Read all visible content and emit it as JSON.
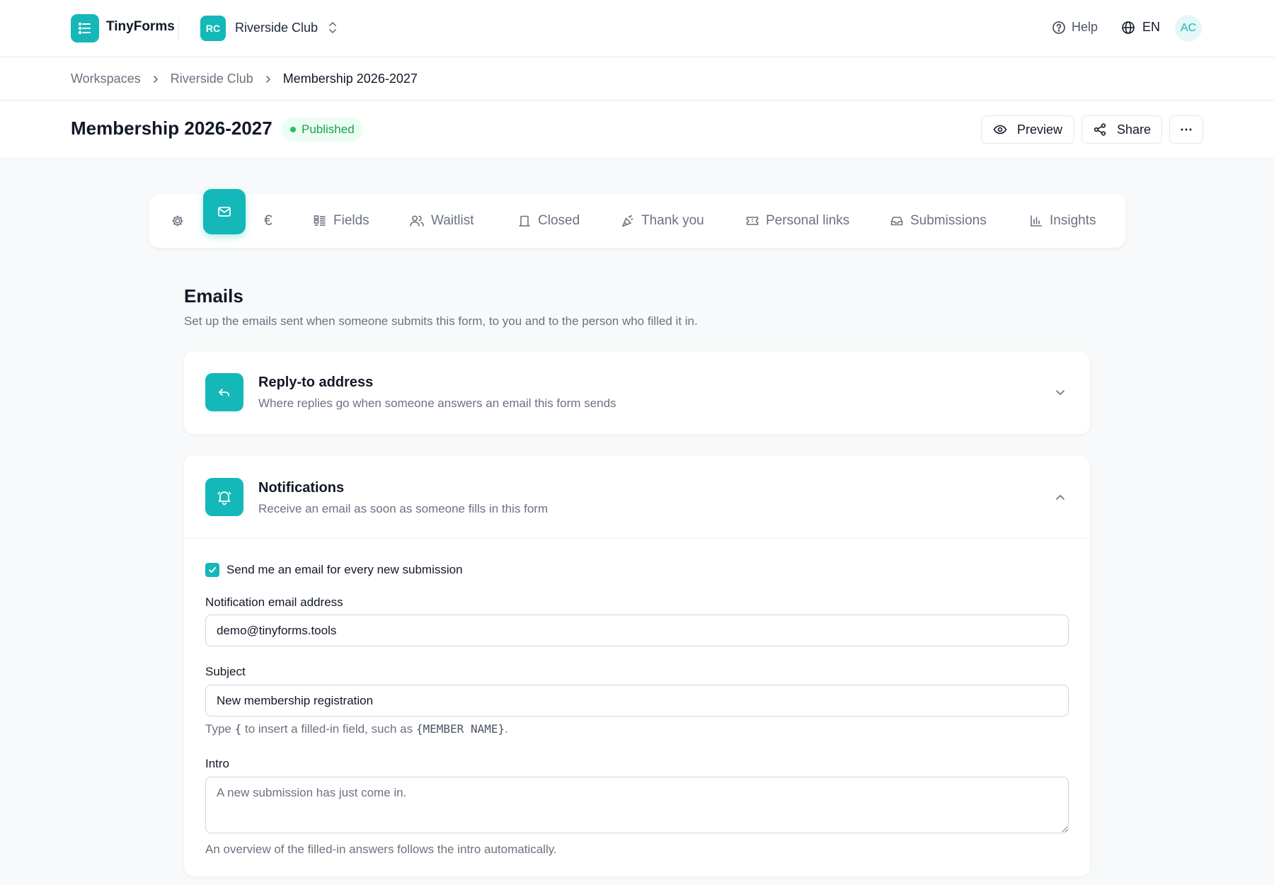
{
  "brand": {
    "name": "TinyForms"
  },
  "workspace": {
    "initials": "RC",
    "name": "Riverside Club"
  },
  "topbar": {
    "help_label": "Help",
    "language": "EN",
    "avatar_initials": "AC"
  },
  "breadcrumb": [
    "Workspaces",
    "Riverside Club",
    "Membership 2026-2027"
  ],
  "page": {
    "title": "Membership 2026-2027",
    "status": "Published",
    "preview_label": "Preview",
    "share_label": "Share",
    "more_label": "⋯"
  },
  "tabs": [
    {
      "icon": "gear-icon",
      "label": ""
    },
    {
      "icon": "mail-icon",
      "label": "",
      "active": true
    },
    {
      "icon": "euro-icon",
      "label": "€"
    },
    {
      "icon": "fields-icon",
      "label": "Fields"
    },
    {
      "icon": "users-icon",
      "label": "Waitlist"
    },
    {
      "icon": "closed-icon",
      "label": "Closed"
    },
    {
      "icon": "party-icon",
      "label": "Thank you"
    },
    {
      "icon": "ticket-icon",
      "label": "Personal links"
    },
    {
      "icon": "inbox-icon",
      "label": "Submissions"
    },
    {
      "icon": "bar-chart-icon",
      "label": "Insights"
    }
  ],
  "emails": {
    "title": "Emails",
    "description": "Set up the emails sent when someone submits this form, to you and to the person who filled it in."
  },
  "reply_to": {
    "title": "Reply-to address",
    "description": "Where replies go when someone answers an email this form sends",
    "expanded": false
  },
  "notifications": {
    "title": "Notifications",
    "description": "Receive an email as soon as someone fills in this form",
    "expanded": true,
    "checkbox_label": "Send me an email for every new submission",
    "checked": true,
    "email_label": "Notification email address",
    "email_value": "demo@tinyforms.tools",
    "subject_label": "Subject",
    "subject_value": "New membership registration",
    "subject_hint_pre": "Type",
    "subject_hint_brace": "{",
    "subject_hint_mid": "to insert a filled-in field, such as",
    "subject_hint_code": "{MEMBER NAME}",
    "subject_hint_post": ".",
    "intro_label": "Intro",
    "intro_placeholder": "A new submission has just come in.",
    "intro_hint": "An overview of the filled-in answers follows the intro automatically."
  },
  "colors": {
    "accent": "#14b8b8",
    "status_green": "#16a34a",
    "muted_text": "#6b7280"
  }
}
